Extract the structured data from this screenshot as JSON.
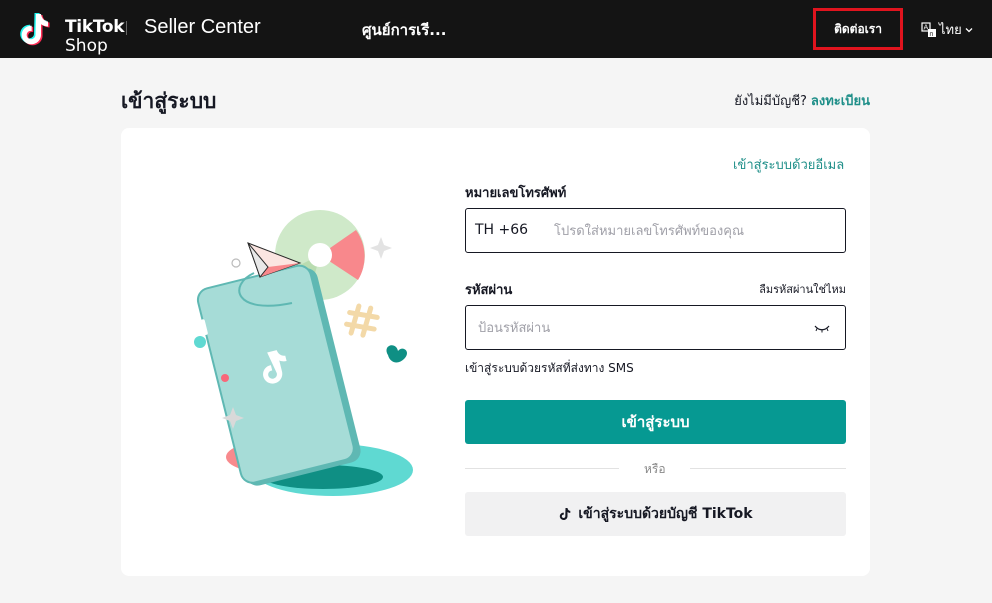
{
  "header": {
    "logo_line1": "TikTok",
    "logo_line2": "Shop",
    "product_name": "Seller Center",
    "nav_learning": "ศูนย์การเรี...",
    "contact_label": "ติดต่อเรา",
    "language_label": "ไทย",
    "icons": [
      "tiktok-logo-icon",
      "translate-icon",
      "chevron-down-icon"
    ]
  },
  "page": {
    "title": "เข้าสู่ระบบ",
    "no_account_text": "ยังไม่มีบัญชี?",
    "signup_label": "ลงทะเบียน"
  },
  "form": {
    "email_login_link": "เข้าสู่ระบบด้วยอีเมล",
    "phone_label": "หมายเลขโทรศัพท์",
    "country_code": "TH +66",
    "phone_placeholder": "โปรดใส่หมายเลขโทรศัพท์ของคุณ",
    "password_label": "รหัสผ่าน",
    "forgot_password": "ลืมรหัสผ่านใช่ไหม",
    "password_placeholder": "ป้อนรหัสผ่าน",
    "sms_login_link": "เข้าสู่ระบบด้วยรหัสที่ส่งทาง SMS",
    "login_button": "เข้าสู่ระบบ",
    "or_text": "หรือ",
    "tiktok_login_button": "เข้าสู่ระบบด้วยบัญชี TikTok"
  },
  "colors": {
    "header_bg": "#141414",
    "accent_teal": "#069992",
    "link_teal": "#1f8f89",
    "highlight_red": "#e0141e",
    "page_bg": "#f5f5f5"
  }
}
